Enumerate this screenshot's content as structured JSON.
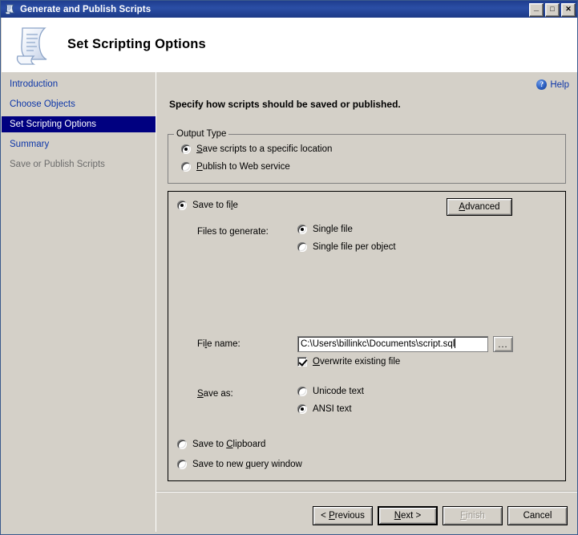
{
  "window": {
    "title": "Generate and Publish Scripts",
    "title_icon": "script-scroll-icon",
    "controls": {
      "minimize": "_",
      "maximize": "□",
      "close": "✕"
    }
  },
  "header": {
    "icon": "script-scroll-icon",
    "title": "Set Scripting Options"
  },
  "sidebar": {
    "items": [
      {
        "label": "Introduction",
        "state": "link"
      },
      {
        "label": "Choose Objects",
        "state": "link"
      },
      {
        "label": "Set Scripting Options",
        "state": "selected"
      },
      {
        "label": "Summary",
        "state": "link"
      },
      {
        "label": "Save or Publish Scripts",
        "state": "disabled"
      }
    ]
  },
  "main": {
    "help": {
      "icon": "help-question-icon",
      "label": "Help"
    },
    "instruction": "Specify how scripts should be saved or published.",
    "output_type": {
      "legend": "Output Type",
      "options": [
        {
          "label_pre": "",
          "label_accel": "S",
          "label_post": "ave scripts to a specific location",
          "selected": true
        },
        {
          "label_pre": "",
          "label_accel": "P",
          "label_post": "ublish to Web service",
          "selected": false
        }
      ]
    },
    "save_panel": {
      "save_to_file": {
        "pre": "Save to fi",
        "accel": "l",
        "post": "e",
        "selected": true
      },
      "advanced_button": {
        "pre": "",
        "accel": "A",
        "post": "dvanced"
      },
      "files_to_generate_label": "Files to generate:",
      "files_to_generate_options": [
        {
          "label": "Single file",
          "selected": true
        },
        {
          "label": "Single file per object",
          "selected": false
        }
      ],
      "file_name_label": {
        "pre": "Fi",
        "accel": "l",
        "post": "e name:"
      },
      "file_name_value": "C:\\Users\\billinkc\\Documents\\script.sql",
      "browse_button": "...",
      "overwrite": {
        "pre": "",
        "accel": "O",
        "post": "verwrite existing file",
        "checked": true
      },
      "save_as_label": {
        "pre": "",
        "accel": "S",
        "post": "ave as:"
      },
      "save_as_options": [
        {
          "label": "Unicode text",
          "selected": false
        },
        {
          "label": "ANSI text",
          "selected": true
        }
      ],
      "save_to_clipboard": {
        "pre": "Save to ",
        "accel": "C",
        "post": "lipboard",
        "selected": false
      },
      "save_to_new_query_window": {
        "pre": "Save to new ",
        "accel": "q",
        "post": "uery window",
        "selected": false
      }
    }
  },
  "footer": {
    "buttons": [
      {
        "pre": "< ",
        "accel": "P",
        "post": "revious",
        "state": "normal"
      },
      {
        "pre": "",
        "accel": "N",
        "post": "ext >",
        "state": "default"
      },
      {
        "pre": "",
        "accel": "F",
        "post": "inish",
        "state": "disabled"
      },
      {
        "pre": "Cancel",
        "accel": "",
        "post": "",
        "state": "normal"
      }
    ]
  },
  "colors": {
    "face": "#d4d0c8",
    "titlebar": "#1f3d8f",
    "link": "#0d36a8",
    "selection": "#000080",
    "disabled_text": "#6b6b6b"
  }
}
